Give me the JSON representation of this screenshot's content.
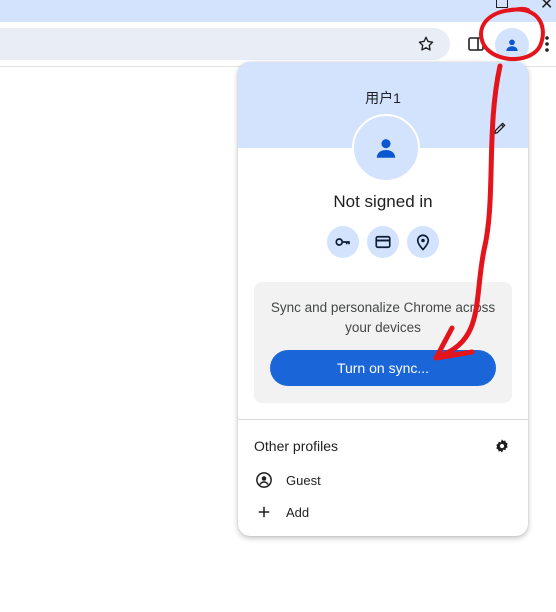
{
  "toolbar": {
    "icons": [
      "star-icon",
      "side-panel-icon",
      "profile-icon",
      "menu-icon"
    ]
  },
  "profile_menu": {
    "profile_name": "用户1",
    "status": "Not signed in",
    "quick_actions": [
      "key-icon",
      "credit-card-icon",
      "location-icon"
    ],
    "sync": {
      "description": "Sync and personalize Chrome across your devices",
      "button_label": "Turn on sync..."
    },
    "other_profiles": {
      "heading": "Other profiles",
      "items": [
        {
          "label": "Guest",
          "icon": "guest-icon"
        },
        {
          "label": "Add",
          "icon": "plus-icon"
        }
      ]
    }
  },
  "colors": {
    "accent": "#1a66d8",
    "header_bg": "#d3e3fd",
    "annotation": "#e3141b"
  }
}
